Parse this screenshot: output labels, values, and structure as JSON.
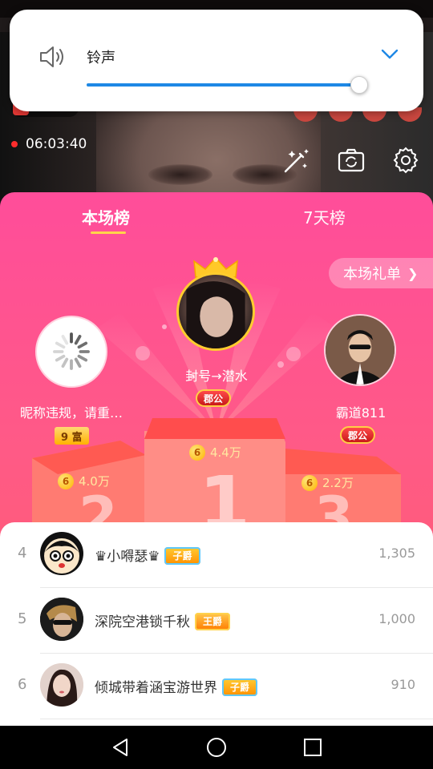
{
  "volume": {
    "label": "铃声",
    "level": 1.0,
    "accent": "#1e88e5"
  },
  "broadcast": {
    "timer": "06:03:40"
  },
  "panel": {
    "tabs": [
      {
        "label": "本场榜",
        "active": true
      },
      {
        "label": "7天榜",
        "active": false
      }
    ],
    "gift_list_button": "本场礼单",
    "podium": {
      "first": {
        "name": "封号→潜水",
        "badge": "郡公",
        "score": "4.4万",
        "number": "1"
      },
      "second": {
        "name": "昵称违规，请重…",
        "badge": "9 富",
        "score": "4.0万",
        "number": "2"
      },
      "third": {
        "name": "霸道811",
        "badge": "郡公",
        "score": "2.2万",
        "number": "3"
      }
    }
  },
  "ranking": [
    {
      "rank": "4",
      "name": "♛小嘚瑟♛",
      "noble": "子爵",
      "score": "1,305"
    },
    {
      "rank": "5",
      "name": "深院空港锁千秋",
      "noble": "王爵",
      "score": "1,000"
    },
    {
      "rank": "6",
      "name": "倾城带着涵宝游世界",
      "noble": "子爵",
      "score": "910"
    }
  ],
  "coin_symbol": "6",
  "icons": [
    "speaker-icon",
    "chevron-down-icon",
    "magic-wand-icon",
    "flip-camera-icon",
    "gear-icon",
    "crown-icon",
    "back-icon",
    "home-icon",
    "recents-icon"
  ]
}
